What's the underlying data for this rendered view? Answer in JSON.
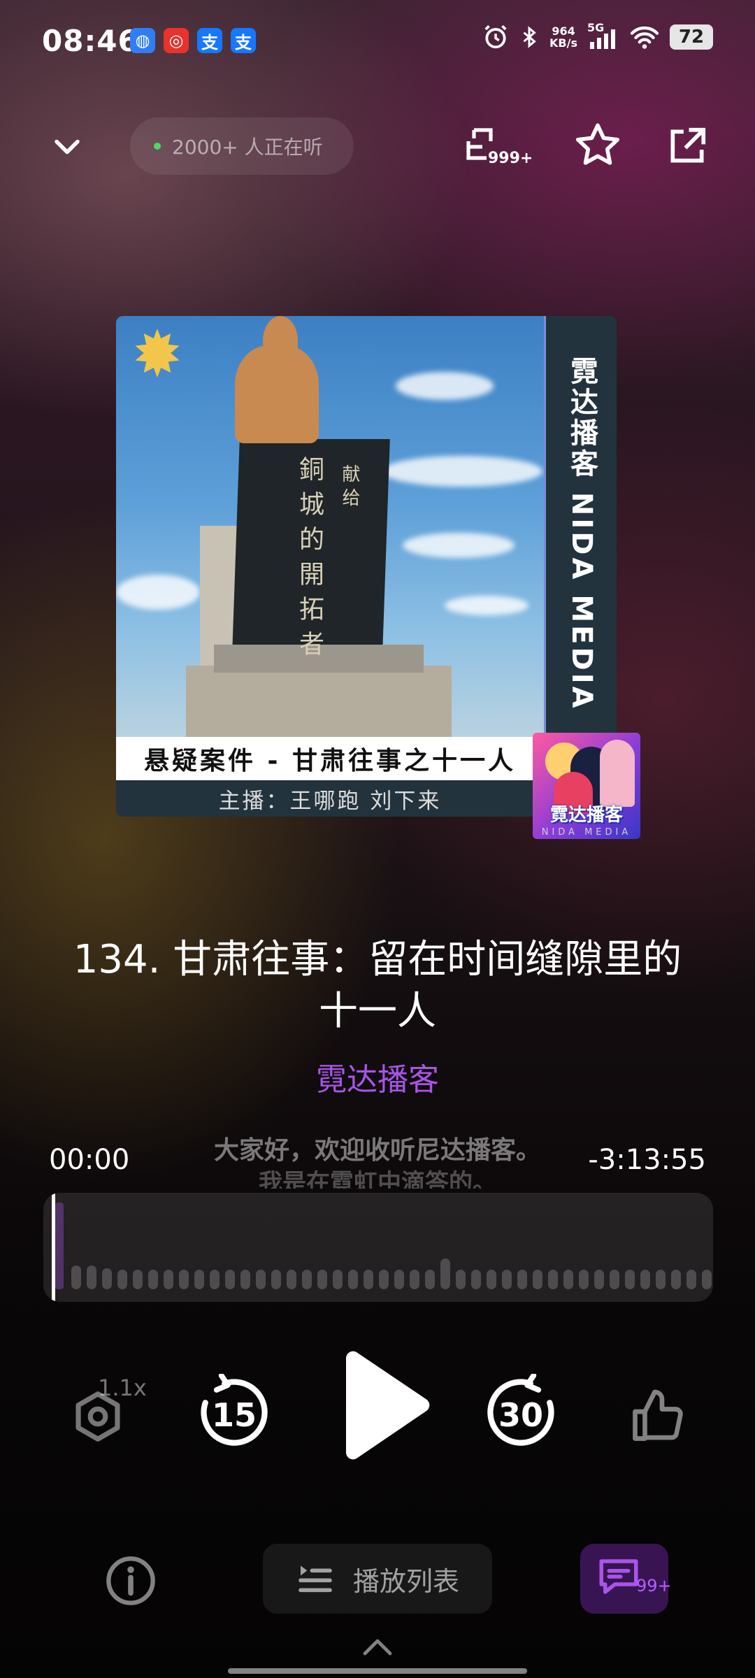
{
  "status_bar": {
    "time": "08:46",
    "app_icons": [
      {
        "name": "browser-app-icon",
        "glyph": "◍",
        "color": "#2f7ef5"
      },
      {
        "name": "netease-music-icon",
        "glyph": "◎",
        "color": "#e8322c"
      },
      {
        "name": "alipay-icon",
        "glyph": "支",
        "color": "#1677ff"
      },
      {
        "name": "alipay-icon-2",
        "glyph": "支",
        "color": "#1677ff"
      }
    ],
    "net_speed_value": "964",
    "net_speed_unit": "KB/s",
    "signal_label": "5G",
    "battery": "72"
  },
  "top_bar": {
    "listeners": "2000+ 人正在听",
    "share_count": "999+"
  },
  "cover": {
    "vertical_title": "霓达播客 NIDA MEDIA",
    "monument_text_main": "銅城的開拓者",
    "monument_text_side": "献给",
    "episode_strip": "悬疑案件 - 甘肃往事之十一人",
    "hosts": "主播：王哪跑 刘下来",
    "logo_text": "霓达播客",
    "logo_sub": "NIDA MEDIA"
  },
  "episode": {
    "title": "134. 甘肃往事：留在时间缝隙里的十一人",
    "channel": "霓达播客"
  },
  "player": {
    "time_elapsed": "00:00",
    "time_remaining": "-3:13:55",
    "lyric_current": "大家好，欢迎收听尼达播客。",
    "lyric_next": "我是在霓虹中滴答的。",
    "progress": 0,
    "speed": "1.1x",
    "rewind_seconds": "15",
    "forward_seconds": "30"
  },
  "bottom_bar": {
    "playlist_label": "播放列表",
    "comment_count": "99+"
  },
  "colors": {
    "accent": "#a855e8",
    "comment_bg": "#4a1f6a"
  }
}
